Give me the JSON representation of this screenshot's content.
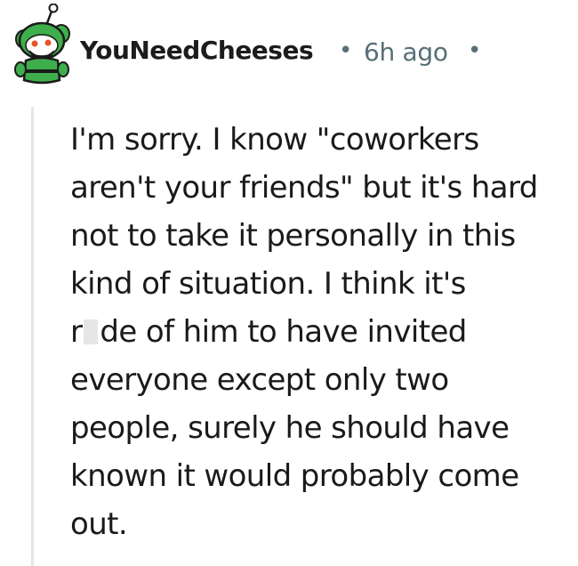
{
  "comment": {
    "author": "YouNeedCheeses",
    "separator": "•",
    "timestamp": "6h ago",
    "avatar_icon": "snoo-avatar-green-icon",
    "lines": [
      "I'm sorry. I know \"coworkers",
      "aren't your friends\" but it's hard",
      "not to take it personally in this",
      "kind of situation. I think it's",
      "",
      "everyone except only two",
      "people, surely he should have",
      "known it would probably come",
      "out."
    ],
    "censored_line": {
      "before": "r",
      "after": "de of him to have invited"
    }
  },
  "colors": {
    "author": "#1c1c1c",
    "meta": "#576f76",
    "body": "#1a1a1b",
    "thread_line": "#e3e6ea",
    "avatar_green": "#3fae4c"
  }
}
